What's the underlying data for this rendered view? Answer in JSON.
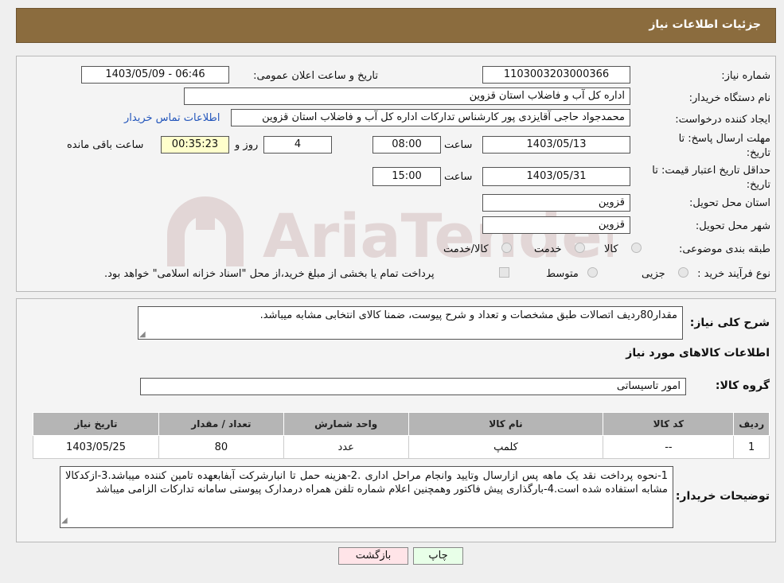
{
  "header": {
    "title": "جزئیات اطلاعات نیاز"
  },
  "info": {
    "need_number_label": "شماره نیاز:",
    "need_number": "1103003203000366",
    "announce_label": "تاریخ و ساعت اعلان عمومی:",
    "announce_value": "1403/05/09 - 06:46",
    "buyer_org_label": "نام دستگاه خریدار:",
    "buyer_org": "اداره کل آب و فاضلاب استان قزوین",
    "creator_label": "ایجاد کننده درخواست:",
    "creator": "محمدجواد حاجی آقایزدی پور کارشناس تدارکات اداره کل آب و فاضلاب استان قزوین",
    "contact_link": "اطلاعات تماس خریدار",
    "deadline_label_1": "مهلت ارسال پاسخ: تا",
    "deadline_label_2": "تاریخ:",
    "deadline_date": "1403/05/13",
    "time_label": "ساعت",
    "deadline_time": "08:00",
    "days": "4",
    "day_label": "روز و",
    "remaining": "00:35:23",
    "remaining_label": "ساعت باقی مانده",
    "validity_label_1": "حداقل تاریخ اعتبار قیمت: تا",
    "validity_label_2": "تاریخ:",
    "validity_date": "1403/05/31",
    "validity_time": "15:00",
    "province_label": "استان محل تحویل:",
    "province": "قزوین",
    "city_label": "شهر محل تحویل:",
    "city": "قزوین",
    "category_label": "طبقه بندی موضوعی:",
    "category_options": [
      "کالا",
      "خدمت",
      "کالا/خدمت"
    ],
    "process_label": "نوع فرآیند خرید :",
    "process_options": [
      "جزیی",
      "متوسط"
    ],
    "process_note": "پرداخت تمام یا بخشی از مبلغ خرید،از محل \"اسناد خزانه اسلامی\" خواهد بود."
  },
  "watermark": "AriaTender.neT",
  "description": {
    "label": "شرح کلی نیاز:",
    "text": "مقدار80ردیف اتصالات طبق مشخصات و تعداد و شرح پیوست، ضمنا کالای انتخابی مشابه میباشد."
  },
  "goods": {
    "title": "اطلاعات کالاهای مورد نیاز",
    "group_label": "گروه کالا:",
    "group_value": "امور تاسیساتی",
    "columns": [
      "ردیف",
      "کد کالا",
      "نام کالا",
      "واحد شمارش",
      "تعداد / مقدار",
      "تاریخ نیاز"
    ],
    "rows": [
      {
        "row": "1",
        "code": "--",
        "name": "کلمپ",
        "unit": "عدد",
        "qty": "80",
        "date": "1403/05/25"
      }
    ]
  },
  "buyer_notes": {
    "label": "توضیحات خریدار:",
    "text": "1-نحوه پرداخت نقد یک ماهه پس ازارسال وتایید وانجام مراحل اداری .2-هزینه حمل تا انبارشرکت آبفابعهده تامین کننده میباشد.3-ازکدکالا مشابه استفاده شده است.4-بارگذاری پیش فاکتور وهمچنین اعلام شماره تلفن همراه درمدارک پیوستی سامانه تدارکات الزامی میباشد"
  },
  "buttons": {
    "print": "چاپ",
    "back": "بازگشت"
  },
  "colors": {
    "header": "#8b6c3e",
    "link": "#2255bb",
    "print_btn": "#e8ffe8",
    "back_btn": "#ffe4e8",
    "remaining_bg": "#ffffcc"
  }
}
